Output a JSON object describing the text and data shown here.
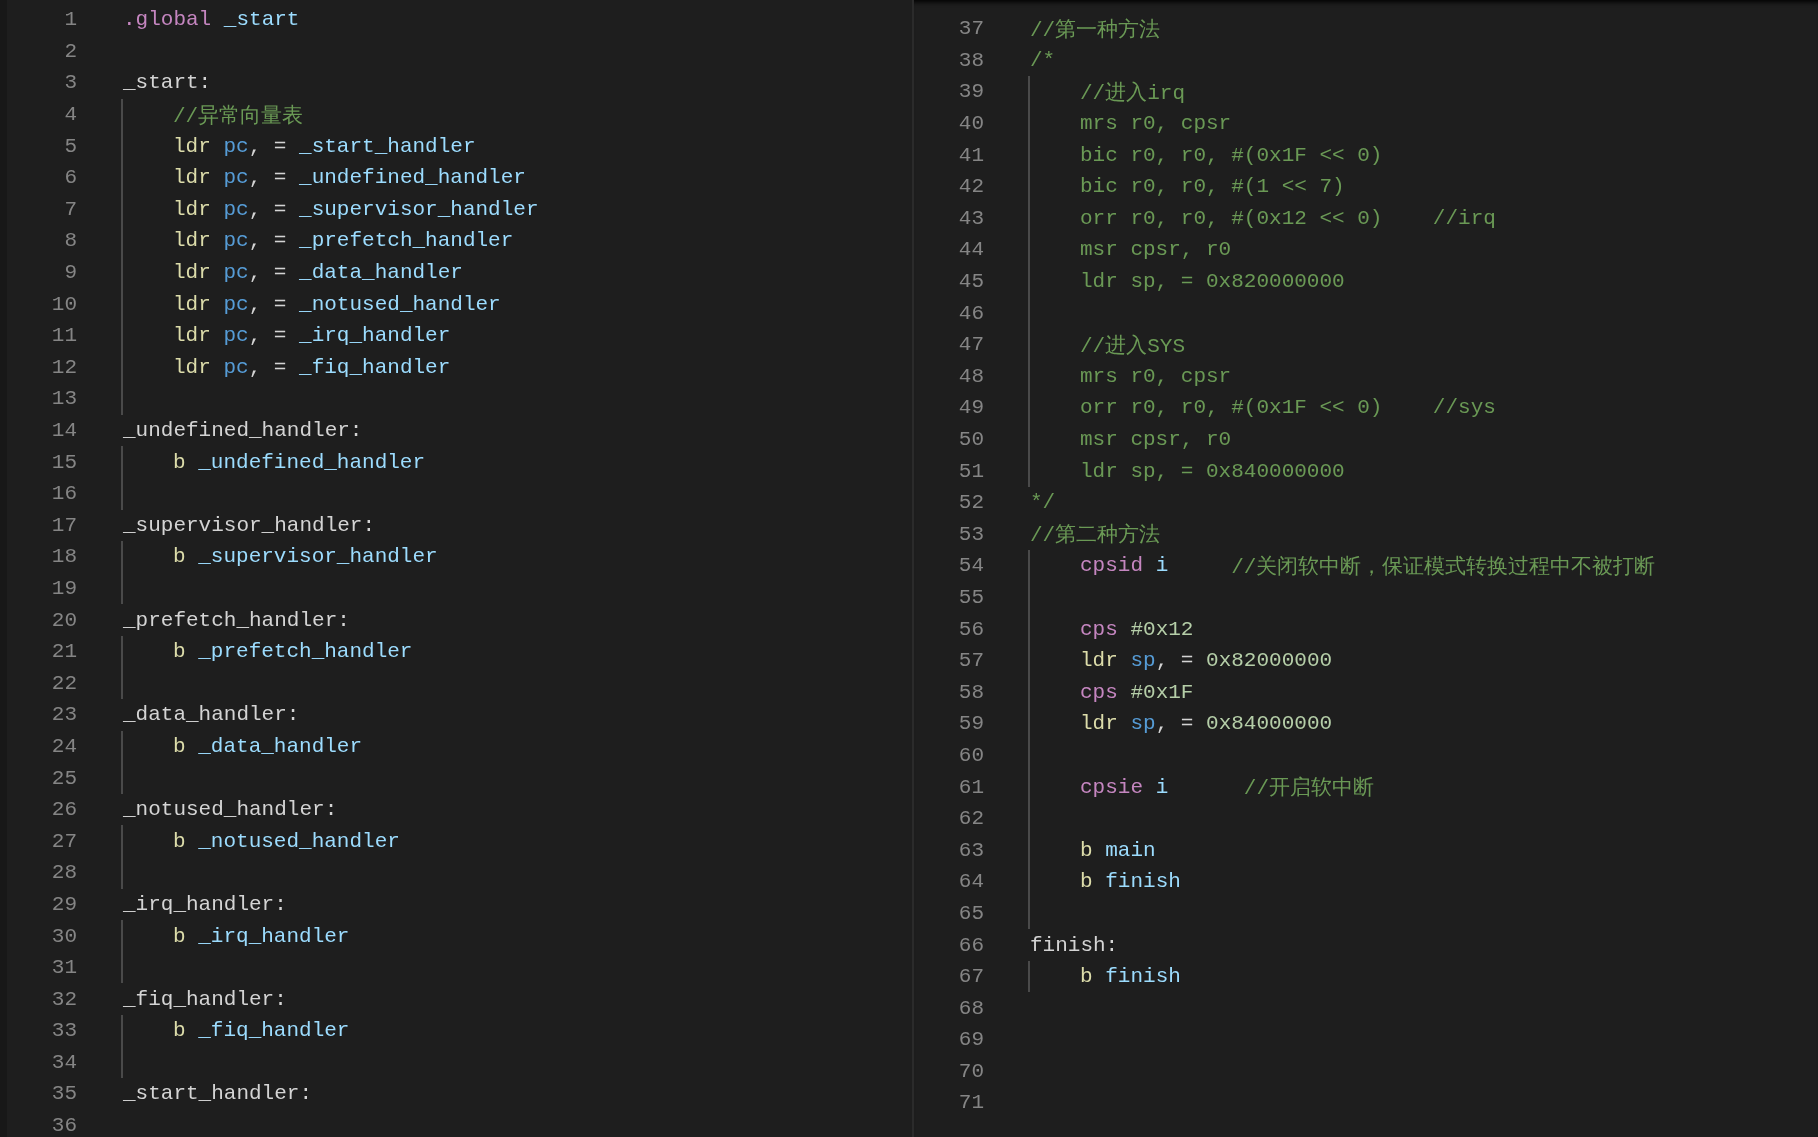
{
  "panes": [
    {
      "lines": [
        {
          "number": "1",
          "indented": false,
          "tokens": [
            {
              "text": ".global ",
              "kind": "keyword"
            },
            {
              "text": "_start",
              "kind": "label"
            }
          ]
        },
        {
          "number": "2",
          "indented": false
        },
        {
          "number": "3",
          "indented": false,
          "tokens": [
            {
              "text": "_start:",
              "kind": "plain"
            }
          ]
        },
        {
          "number": "4",
          "indented": true,
          "tokens": [
            {
              "text": "//异常向量表",
              "kind": "comment"
            }
          ]
        },
        {
          "number": "5",
          "indented": true,
          "tokens": [
            {
              "text": "ldr ",
              "kind": "instruction"
            },
            {
              "text": "pc",
              "kind": "register"
            },
            {
              "text": ", = ",
              "kind": "plain"
            },
            {
              "text": "_start_handler",
              "kind": "label"
            }
          ]
        },
        {
          "number": "6",
          "indented": true,
          "tokens": [
            {
              "text": "ldr ",
              "kind": "instruction"
            },
            {
              "text": "pc",
              "kind": "register"
            },
            {
              "text": ", = ",
              "kind": "plain"
            },
            {
              "text": "_undefined_handler",
              "kind": "label"
            }
          ]
        },
        {
          "number": "7",
          "indented": true,
          "tokens": [
            {
              "text": "ldr ",
              "kind": "instruction"
            },
            {
              "text": "pc",
              "kind": "register"
            },
            {
              "text": ", = ",
              "kind": "plain"
            },
            {
              "text": "_supervisor_handler",
              "kind": "label"
            }
          ]
        },
        {
          "number": "8",
          "indented": true,
          "tokens": [
            {
              "text": "ldr ",
              "kind": "instruction"
            },
            {
              "text": "pc",
              "kind": "register"
            },
            {
              "text": ", = ",
              "kind": "plain"
            },
            {
              "text": "_prefetch_handler",
              "kind": "label"
            }
          ]
        },
        {
          "number": "9",
          "indented": true,
          "tokens": [
            {
              "text": "ldr ",
              "kind": "instruction"
            },
            {
              "text": "pc",
              "kind": "register"
            },
            {
              "text": ", = ",
              "kind": "plain"
            },
            {
              "text": "_data_handler",
              "kind": "label"
            }
          ]
        },
        {
          "number": "10",
          "indented": true,
          "tokens": [
            {
              "text": "ldr ",
              "kind": "instruction"
            },
            {
              "text": "pc",
              "kind": "register"
            },
            {
              "text": ", = ",
              "kind": "plain"
            },
            {
              "text": "_notused_handler",
              "kind": "label"
            }
          ]
        },
        {
          "number": "11",
          "indented": true,
          "tokens": [
            {
              "text": "ldr ",
              "kind": "instruction"
            },
            {
              "text": "pc",
              "kind": "register"
            },
            {
              "text": ", = ",
              "kind": "plain"
            },
            {
              "text": "_irq_handler",
              "kind": "label"
            }
          ]
        },
        {
          "number": "12",
          "indented": true,
          "tokens": [
            {
              "text": "ldr ",
              "kind": "instruction"
            },
            {
              "text": "pc",
              "kind": "register"
            },
            {
              "text": ", = ",
              "kind": "plain"
            },
            {
              "text": "_fiq_handler",
              "kind": "label"
            }
          ]
        },
        {
          "number": "13",
          "indented": true
        },
        {
          "number": "14",
          "indented": false,
          "tokens": [
            {
              "text": "_undefined_handler:",
              "kind": "plain"
            }
          ]
        },
        {
          "number": "15",
          "indented": true,
          "tokens": [
            {
              "text": "b ",
              "kind": "instruction"
            },
            {
              "text": "_undefined_handler",
              "kind": "label"
            }
          ]
        },
        {
          "number": "16",
          "indented": true
        },
        {
          "number": "17",
          "indented": false,
          "tokens": [
            {
              "text": "_supervisor_handler:",
              "kind": "plain"
            }
          ]
        },
        {
          "number": "18",
          "indented": true,
          "tokens": [
            {
              "text": "b ",
              "kind": "instruction"
            },
            {
              "text": "_supervisor_handler",
              "kind": "label"
            }
          ]
        },
        {
          "number": "19",
          "indented": true
        },
        {
          "number": "20",
          "indented": false,
          "tokens": [
            {
              "text": "_prefetch_handler:",
              "kind": "plain"
            }
          ]
        },
        {
          "number": "21",
          "indented": true,
          "tokens": [
            {
              "text": "b ",
              "kind": "instruction"
            },
            {
              "text": "_prefetch_handler",
              "kind": "label"
            }
          ]
        },
        {
          "number": "22",
          "indented": true
        },
        {
          "number": "23",
          "indented": false,
          "tokens": [
            {
              "text": "_data_handler:",
              "kind": "plain"
            }
          ]
        },
        {
          "number": "24",
          "indented": true,
          "tokens": [
            {
              "text": "b ",
              "kind": "instruction"
            },
            {
              "text": "_data_handler",
              "kind": "label"
            }
          ]
        },
        {
          "number": "25",
          "indented": true
        },
        {
          "number": "26",
          "indented": false,
          "tokens": [
            {
              "text": "_notused_handler:",
              "kind": "plain"
            }
          ]
        },
        {
          "number": "27",
          "indented": true,
          "tokens": [
            {
              "text": "b ",
              "kind": "instruction"
            },
            {
              "text": "_notused_handler",
              "kind": "label"
            }
          ]
        },
        {
          "number": "28",
          "indented": true
        },
        {
          "number": "29",
          "indented": false,
          "tokens": [
            {
              "text": "_irq_handler:",
              "kind": "plain"
            }
          ]
        },
        {
          "number": "30",
          "indented": true,
          "tokens": [
            {
              "text": "b ",
              "kind": "instruction"
            },
            {
              "text": "_irq_handler",
              "kind": "label"
            }
          ]
        },
        {
          "number": "31",
          "indented": true
        },
        {
          "number": "32",
          "indented": false,
          "tokens": [
            {
              "text": "_fiq_handler:",
              "kind": "plain"
            }
          ]
        },
        {
          "number": "33",
          "indented": true,
          "tokens": [
            {
              "text": "b ",
              "kind": "instruction"
            },
            {
              "text": "_fiq_handler",
              "kind": "label"
            }
          ]
        },
        {
          "number": "34",
          "indented": true
        },
        {
          "number": "35",
          "indented": false,
          "tokens": [
            {
              "text": "_start_handler:",
              "kind": "plain"
            }
          ]
        },
        {
          "number": "36",
          "indented": false
        }
      ]
    },
    {
      "lines": [
        {
          "number": "37",
          "indented": false,
          "tokens": [
            {
              "text": "//第一种方法",
              "kind": "comment"
            }
          ]
        },
        {
          "number": "38",
          "indented": false,
          "tokens": [
            {
              "text": "/*",
              "kind": "comment"
            }
          ]
        },
        {
          "number": "39",
          "indented": true,
          "tokens": [
            {
              "text": "//进入irq",
              "kind": "comment"
            }
          ]
        },
        {
          "number": "40",
          "indented": true,
          "tokens": [
            {
              "text": "mrs r0, cpsr",
              "kind": "comment"
            }
          ]
        },
        {
          "number": "41",
          "indented": true,
          "tokens": [
            {
              "text": "bic r0, r0, #(0x1F << 0)",
              "kind": "comment"
            }
          ]
        },
        {
          "number": "42",
          "indented": true,
          "tokens": [
            {
              "text": "bic r0, r0, #(1 << 7)",
              "kind": "comment"
            }
          ]
        },
        {
          "number": "43",
          "indented": true,
          "tokens": [
            {
              "text": "orr r0, r0, #(0x12 << 0)    //irq",
              "kind": "comment"
            }
          ]
        },
        {
          "number": "44",
          "indented": true,
          "tokens": [
            {
              "text": "msr cpsr, r0",
              "kind": "comment"
            }
          ]
        },
        {
          "number": "45",
          "indented": true,
          "tokens": [
            {
              "text": "ldr sp, = 0x820000000",
              "kind": "comment"
            }
          ]
        },
        {
          "number": "46",
          "indented": true
        },
        {
          "number": "47",
          "indented": true,
          "tokens": [
            {
              "text": "//进入SYS",
              "kind": "comment"
            }
          ]
        },
        {
          "number": "48",
          "indented": true,
          "tokens": [
            {
              "text": "mrs r0, cpsr",
              "kind": "comment"
            }
          ]
        },
        {
          "number": "49",
          "indented": true,
          "tokens": [
            {
              "text": "orr r0, r0, #(0x1F << 0)    //sys",
              "kind": "comment"
            }
          ]
        },
        {
          "number": "50",
          "indented": true,
          "tokens": [
            {
              "text": "msr cpsr, r0",
              "kind": "comment"
            }
          ]
        },
        {
          "number": "51",
          "indented": true,
          "tokens": [
            {
              "text": "ldr sp, = 0x840000000",
              "kind": "comment"
            }
          ]
        },
        {
          "number": "52",
          "indented": false,
          "tokens": [
            {
              "text": "*/",
              "kind": "comment"
            }
          ]
        },
        {
          "number": "53",
          "indented": false,
          "tokens": [
            {
              "text": "//第二种方法",
              "kind": "comment"
            }
          ]
        },
        {
          "number": "54",
          "indented": true,
          "tokens": [
            {
              "text": "cpsid ",
              "kind": "keyword"
            },
            {
              "text": "i     ",
              "kind": "label"
            },
            {
              "text": "//关闭软中断，保证模式转换过程中不被打断",
              "kind": "comment"
            }
          ]
        },
        {
          "number": "55",
          "indented": true
        },
        {
          "number": "56",
          "indented": true,
          "tokens": [
            {
              "text": "cps ",
              "kind": "keyword"
            },
            {
              "text": "#0x12",
              "kind": "number"
            }
          ]
        },
        {
          "number": "57",
          "indented": true,
          "tokens": [
            {
              "text": "ldr ",
              "kind": "instruction"
            },
            {
              "text": "sp",
              "kind": "register"
            },
            {
              "text": ", = ",
              "kind": "plain"
            },
            {
              "text": "0x82000000",
              "kind": "number"
            }
          ]
        },
        {
          "number": "58",
          "indented": true,
          "tokens": [
            {
              "text": "cps ",
              "kind": "keyword"
            },
            {
              "text": "#0x1F",
              "kind": "number"
            }
          ]
        },
        {
          "number": "59",
          "indented": true,
          "tokens": [
            {
              "text": "ldr ",
              "kind": "instruction"
            },
            {
              "text": "sp",
              "kind": "register"
            },
            {
              "text": ", = ",
              "kind": "plain"
            },
            {
              "text": "0x84000000",
              "kind": "number"
            }
          ]
        },
        {
          "number": "60",
          "indented": true
        },
        {
          "number": "61",
          "indented": true,
          "tokens": [
            {
              "text": "cpsie ",
              "kind": "keyword"
            },
            {
              "text": "i      ",
              "kind": "label"
            },
            {
              "text": "//开启软中断",
              "kind": "comment"
            }
          ]
        },
        {
          "number": "62",
          "indented": true
        },
        {
          "number": "63",
          "indented": true,
          "tokens": [
            {
              "text": "b ",
              "kind": "instruction"
            },
            {
              "text": "main",
              "kind": "label"
            }
          ]
        },
        {
          "number": "64",
          "indented": true,
          "tokens": [
            {
              "text": "b ",
              "kind": "instruction"
            },
            {
              "text": "finish",
              "kind": "label"
            }
          ]
        },
        {
          "number": "65",
          "indented": true
        },
        {
          "number": "66",
          "indented": false,
          "tokens": [
            {
              "text": "finish:",
              "kind": "plain"
            }
          ]
        },
        {
          "number": "67",
          "indented": true,
          "tokens": [
            {
              "text": "b ",
              "kind": "instruction"
            },
            {
              "text": "finish",
              "kind": "label"
            }
          ]
        },
        {
          "number": "68",
          "indented": false
        },
        {
          "number": "69",
          "indented": false
        },
        {
          "number": "70",
          "indented": false
        },
        {
          "number": "71",
          "indented": false
        }
      ]
    }
  ]
}
